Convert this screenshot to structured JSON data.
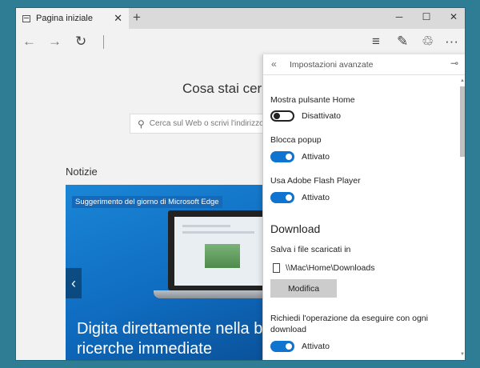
{
  "browser": {
    "tab_title": "Pagina iniziale",
    "tab_close_glyph": "✕",
    "new_tab_glyph": "+",
    "window_controls": {
      "minimize": "─",
      "maximize": "☐",
      "close": "✕"
    },
    "nav": {
      "back": "←",
      "forward": "→",
      "refresh": "↻"
    },
    "toolbar_icons": {
      "hub": "≡",
      "notes": "✎",
      "share": "♲",
      "more": "···"
    }
  },
  "page": {
    "heading": "Cosa stai cerc",
    "search_placeholder": "Cerca sul Web o scrivi l'indirizzo d",
    "search_glyph": "⚲",
    "news_title": "Notizie",
    "hero_tag": "Suggerimento del giorno di Microsoft Edge",
    "hero_caption_line1": "Digita direttamente nella ba",
    "hero_caption_line2": "ricerche immediate",
    "hero_prev_glyph": "‹"
  },
  "settings": {
    "back_glyph": "«",
    "title": "Impostazioni avanzate",
    "pin_glyph": "⊸",
    "scroll_up_glyph": "▲",
    "scroll_down_glyph": "▼",
    "options": [
      {
        "label": "Mostra pulsante Home",
        "state": "Disattivato",
        "on": false
      },
      {
        "label": "Blocca popup",
        "state": "Attivato",
        "on": true
      },
      {
        "label": "Usa Adobe Flash Player",
        "state": "Attivato",
        "on": true
      }
    ],
    "download": {
      "section_title": "Download",
      "save_label": "Salva i file scaricati in",
      "path": "\\\\Mac\\Home\\Downloads",
      "modify_button": "Modifica",
      "ask_label_line1": "Richiedi l'operazione da eseguire con ogni",
      "ask_label_line2": "download",
      "ask_state": "Attivato",
      "ask_on": true
    }
  },
  "colors": {
    "accent": "#0f73d0",
    "desktop": "#2e7d95",
    "hero": "#1b86d6"
  }
}
